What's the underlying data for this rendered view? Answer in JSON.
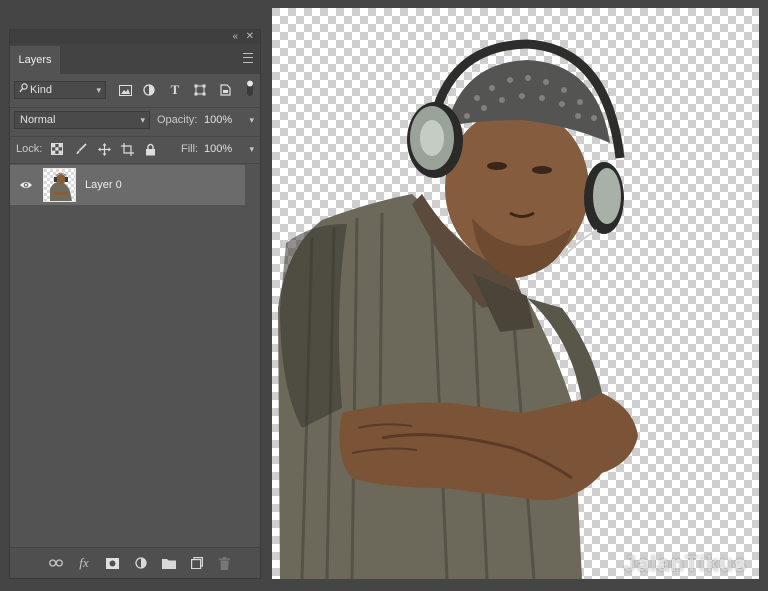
{
  "panel": {
    "collapse_glyph": "«",
    "close_glyph": "✕",
    "tab_label": "Layers",
    "filter": {
      "label": "Kind",
      "icon": "search-icon"
    },
    "blend_mode": "Normal",
    "opacity_label": "Opacity:",
    "opacity_value": "100%",
    "lock_label": "Lock:",
    "fill_label": "Fill:",
    "fill_value": "100%",
    "layers": [
      {
        "name": "Layer 0",
        "visible": true,
        "selected": true
      }
    ]
  },
  "canvas": {
    "watermark": "JalanTikus"
  },
  "colors": {
    "panel_bg": "#535353",
    "selected_row": "#6b6b6b",
    "app_bg": "#454545"
  }
}
